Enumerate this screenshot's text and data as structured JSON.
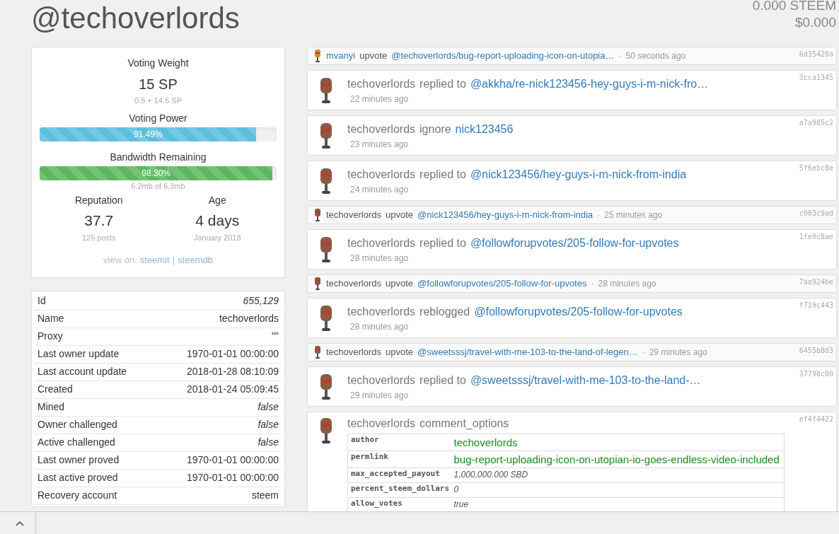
{
  "title": "@techoverlords",
  "time_separator": "·",
  "balance": {
    "steem": "0.000 STEEM",
    "usd": "$0.000"
  },
  "stats": {
    "voting_weight_label": "Voting Weight",
    "voting_weight": "15 SP",
    "voting_weight_detail": "0.5 + 14.5 SP",
    "voting_power_label": "Voting Power",
    "voting_power": {
      "level": 0.9149,
      "reading": "91.49%"
    },
    "bandwidth_label": "Bandwidth Remaining",
    "bandwidth": {
      "level": 0.983,
      "reading": "98.30%"
    },
    "bandwidth_detail": "6.2mb of 6.3mb",
    "reputation_label": "Reputation",
    "reputation": "37.7",
    "reputation_detail": "125 posts",
    "age_label": "Age",
    "age": "4 days",
    "age_detail": "January 2018",
    "view_on": "view on:",
    "links": [
      "steemit",
      "steemdb"
    ],
    "separator": "|"
  },
  "account": [
    {
      "label": "Id",
      "value": "655,129",
      "italic": true
    },
    {
      "label": "Name",
      "value": "techoverlords",
      "italic": false
    },
    {
      "label": "Proxy",
      "value": "\"\"",
      "italic": false
    },
    {
      "label": "Last owner update",
      "value": "1970-01-01 00:00:00",
      "italic": false
    },
    {
      "label": "Last account update",
      "value": "2018-01-28 08:10:09",
      "italic": false
    },
    {
      "label": "Created",
      "value": "2018-01-24 05:09:45",
      "italic": false
    },
    {
      "label": "Mined",
      "value": "false",
      "italic": true
    },
    {
      "label": "Owner challenged",
      "value": "false",
      "italic": true
    },
    {
      "label": "Active challenged",
      "value": "false",
      "italic": true
    },
    {
      "label": "Last owner proved",
      "value": "1970-01-01 00:00:00",
      "italic": false
    },
    {
      "label": "Last active proved",
      "value": "1970-01-01 00:00:00",
      "italic": false
    },
    {
      "label": "Recovery account",
      "value": "steem",
      "italic": false
    }
  ],
  "feed": [
    {
      "kind": "small",
      "color": "#d98c1f",
      "actor": "mvanyi",
      "action": "upvote",
      "target": "@techoverlords/bug-report-uploading-icon-on-utopia…",
      "time": "50 seconds ago",
      "hash": "6d35420a"
    },
    {
      "kind": "big",
      "color": "#8a5a44",
      "actor": "techoverlords",
      "action": "replied to",
      "target": "@akkha/re-nick123456-hey-guys-i-m-nick-fro…",
      "time": "22 minutes ago",
      "hash": "3cca1345"
    },
    {
      "kind": "big",
      "color": "#8a5a44",
      "actor": "techoverlords",
      "action": "ignore",
      "target": "nick123456",
      "time": "23 minutes ago",
      "hash": "a7a985c2"
    },
    {
      "kind": "big",
      "color": "#8a5a44",
      "actor": "techoverlords",
      "action": "replied to",
      "target": "@nick123456/hey-guys-i-m-nick-from-india",
      "time": "24 minutes ago",
      "hash": "5f6ebc8e"
    },
    {
      "kind": "small",
      "color": "#8a5a44",
      "actor": "techoverlords",
      "action": "upvote",
      "target": "@nick123456/hey-guys-i-m-nick-from-india",
      "time": "25 minutes ago",
      "hash": "c003c9ad"
    },
    {
      "kind": "big",
      "color": "#8a5a44",
      "actor": "techoverlords",
      "action": "replied to",
      "target": "@followforupvotes/205-follow-for-upvotes",
      "time": "28 minutes ago",
      "hash": "1fe0c8ae"
    },
    {
      "kind": "small",
      "color": "#8a5a44",
      "actor": "techoverlords",
      "action": "upvote",
      "target": "@followforupvotes/205-follow-for-upvotes",
      "time": "28 minutes ago",
      "hash": "7aa924be"
    },
    {
      "kind": "big",
      "color": "#8a5a44",
      "actor": "techoverlords",
      "action": "reblogged",
      "target": "@followforupvotes/205-follow-for-upvotes",
      "time": "28 minutes ago",
      "hash": "f719c443"
    },
    {
      "kind": "small",
      "color": "#8a5a44",
      "actor": "techoverlords",
      "action": "upvote",
      "target": "@sweetsssj/travel-with-me-103-to-the-land-of-legen…",
      "time": "29 minutes ago",
      "hash": "6455b8d3"
    },
    {
      "kind": "big",
      "color": "#8a5a44",
      "actor": "techoverlords",
      "action": "replied to",
      "target": "@sweetsssj/travel-with-me-103-to-the-land-…",
      "time": "29 minutes ago",
      "hash": "37798c00"
    },
    {
      "kind": "options",
      "color": "#8a5a44",
      "actor": "techoverlords",
      "action": "comment_options",
      "hash": "ef4f4422",
      "fields": [
        {
          "key": "author",
          "value": "techoverlords",
          "kind": "link"
        },
        {
          "key": "permlink",
          "value": "bug-report-uploading-icon-on-utopian-io-goes-endless-video-included",
          "kind": "link"
        },
        {
          "key": "max_accepted_payout",
          "value": "1,000,000.000 SBD",
          "kind": "plain"
        },
        {
          "key": "percent_steem_dollars",
          "value": "0",
          "kind": "plain"
        },
        {
          "key": "allow_votes",
          "value": "true",
          "kind": "plain"
        }
      ]
    }
  ]
}
